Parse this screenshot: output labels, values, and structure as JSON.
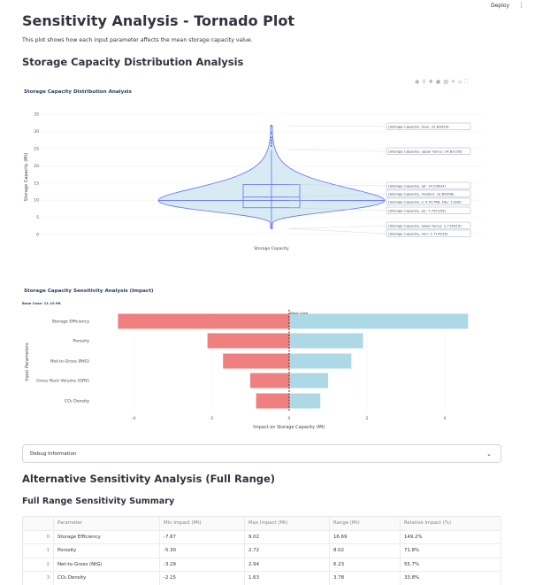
{
  "toolbar": {
    "deploy": "Deploy",
    "menu_icon": "kebab-menu-icon"
  },
  "page": {
    "title": "Sensitivity Analysis - Tornado Plot",
    "intro": "This plot shows how each input parameter affects the mean storage capacity value.",
    "section1": "Storage Capacity Distribution Analysis",
    "section2": "Alternative Sensitivity Analysis (Full Range)",
    "subsection": "Full Range Sensitivity Summary"
  },
  "modebar_icons": [
    "camera-icon",
    "zoom-icon",
    "pan-icon",
    "zoom-in-icon",
    "zoom-out-icon",
    "autoscale-icon",
    "home-icon",
    "fullscreen-icon"
  ],
  "debug_expander": {
    "label": "Debug Information",
    "icon": "chevron-down-icon"
  },
  "colors": {
    "violin_fill": "#d4e9f2",
    "violin_line": "#636efa",
    "neg_bar": "#f08080",
    "pos_bar": "#add8e6"
  },
  "chart_data": [
    {
      "type": "violin",
      "title": "Storage Capacity Distribution Analysis",
      "ylabel": "Storage Capacity (Mt)",
      "xlabel": "Storage Capacity",
      "ylim": [
        0,
        35
      ],
      "yticks": [
        "0",
        "5",
        "10",
        "15",
        "20",
        "25",
        "30",
        "35"
      ],
      "stats": {
        "max": 31.63,
        "upper_fence": 24.61,
        "q3": 14.54,
        "median": 10.89,
        "kde_peak": 9.92,
        "q1": 7.79,
        "lower_fence": 1.71,
        "min": 1.71
      },
      "hover_labels": [
        "(Storage Capacity, max: 31.63035)",
        "(Storage Capacity, upper fence: 24.61158)",
        "(Storage Capacity, q3: 14.53633)",
        "(Storage Capacity, median: 10.89398)",
        "(Storage Capacity, y: 9.91788, kde: 1.000)",
        "(Storage Capacity, q1: 7.791359)",
        "(Storage Capacity, lower fence: 1.714019)",
        "(Storage Capacity, min: 1.714019)"
      ]
    },
    {
      "type": "bar",
      "orientation": "horizontal",
      "title": "Storage Capacity Sensitivity Analysis (Impact)",
      "subtitle": "Base Case: 11.10 Mt",
      "xlabel": "Impact on Storage Capacity (Mt)",
      "ylabel": "Input Parameters",
      "xlim": [
        -4.6,
        4.6
      ],
      "xticks": [
        "-4",
        "-2",
        "0",
        "2",
        "4"
      ],
      "base_case_label": "Base Case",
      "categories": [
        "Storage Efficiency",
        "Porosity",
        "Net-to-Gross (NtG)",
        "Gross Rock Volume (GRV)",
        "CO₂ Density"
      ],
      "series": [
        {
          "values": [
            -4.4,
            -2.1,
            -1.7,
            -1.0,
            -0.85
          ]
        },
        {
          "values": [
            4.6,
            1.9,
            1.6,
            1.0,
            0.8
          ]
        }
      ]
    }
  ],
  "table": {
    "columns": [
      "",
      "Parameter",
      "Min Impact (Mt)",
      "Max Impact (Mt)",
      "Range (Mt)",
      "Relative Impact (%)"
    ],
    "rows": [
      [
        "0",
        "Storage Efficiency",
        "-7.67",
        "9.02",
        "16.69",
        "149.2%"
      ],
      [
        "1",
        "Porosity",
        "-5.30",
        "2.72",
        "8.02",
        "71.8%"
      ],
      [
        "2",
        "Net-to-Gross (NtG)",
        "-3.29",
        "2.94",
        "6.23",
        "55.7%"
      ],
      [
        "3",
        "CO₂ Density",
        "-2.15",
        "1.63",
        "3.78",
        "33.8%"
      ]
    ]
  }
}
